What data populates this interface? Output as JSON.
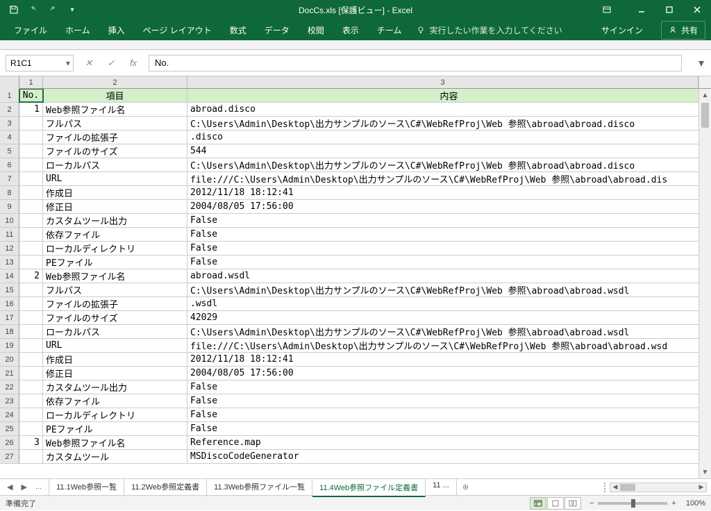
{
  "title": "DocCs.xls  [保護ビュー] - Excel",
  "ribbon": {
    "tabs": [
      "ファイル",
      "ホーム",
      "挿入",
      "ページ レイアウト",
      "数式",
      "データ",
      "校閲",
      "表示",
      "チーム"
    ],
    "tell_me": "実行したい作業を入力してください",
    "signin": "サインイン",
    "share": "共有"
  },
  "formula": {
    "name_box": "R1C1",
    "value": "No."
  },
  "columns": [
    "1",
    "2",
    "3"
  ],
  "header_row": {
    "no": "No.",
    "item": "項目",
    "content": "内容"
  },
  "rows": [
    {
      "rh": "1",
      "no": "",
      "item": "",
      "content": "",
      "header": true
    },
    {
      "rh": "2",
      "no": "1",
      "item": "Web参照ファイル名",
      "content": "abroad.disco"
    },
    {
      "rh": "3",
      "no": "",
      "item": "フルパス",
      "content": "C:\\Users\\Admin\\Desktop\\出力サンプルのソース\\C#\\WebRefProj\\Web 参照\\abroad\\abroad.disco"
    },
    {
      "rh": "4",
      "no": "",
      "item": "ファイルの拡張子",
      "content": ".disco"
    },
    {
      "rh": "5",
      "no": "",
      "item": "ファイルのサイズ",
      "content": "544"
    },
    {
      "rh": "6",
      "no": "",
      "item": "ローカルパス",
      "content": "C:\\Users\\Admin\\Desktop\\出力サンプルのソース\\C#\\WebRefProj\\Web 参照\\abroad\\abroad.disco"
    },
    {
      "rh": "7",
      "no": "",
      "item": "URL",
      "content": "file:///C:\\Users\\Admin\\Desktop\\出力サンプルのソース\\C#\\WebRefProj\\Web 参照\\abroad\\abroad.dis"
    },
    {
      "rh": "8",
      "no": "",
      "item": "作成日",
      "content": "2012/11/18 18:12:41"
    },
    {
      "rh": "9",
      "no": "",
      "item": "修正日",
      "content": "2004/08/05 17:56:00"
    },
    {
      "rh": "10",
      "no": "",
      "item": "カスタムツール出力",
      "content": "False"
    },
    {
      "rh": "11",
      "no": "",
      "item": "依存ファイル",
      "content": "False"
    },
    {
      "rh": "12",
      "no": "",
      "item": "ローカルディレクトリ",
      "content": "False"
    },
    {
      "rh": "13",
      "no": "",
      "item": "PEファイル",
      "content": "False"
    },
    {
      "rh": "14",
      "no": "2",
      "item": "Web参照ファイル名",
      "content": "abroad.wsdl"
    },
    {
      "rh": "15",
      "no": "",
      "item": "フルパス",
      "content": "C:\\Users\\Admin\\Desktop\\出力サンプルのソース\\C#\\WebRefProj\\Web 参照\\abroad\\abroad.wsdl"
    },
    {
      "rh": "16",
      "no": "",
      "item": "ファイルの拡張子",
      "content": ".wsdl"
    },
    {
      "rh": "17",
      "no": "",
      "item": "ファイルのサイズ",
      "content": "42029"
    },
    {
      "rh": "18",
      "no": "",
      "item": "ローカルパス",
      "content": "C:\\Users\\Admin\\Desktop\\出力サンプルのソース\\C#\\WebRefProj\\Web 参照\\abroad\\abroad.wsdl"
    },
    {
      "rh": "19",
      "no": "",
      "item": "URL",
      "content": "file:///C:\\Users\\Admin\\Desktop\\出力サンプルのソース\\C#\\WebRefProj\\Web 参照\\abroad\\abroad.wsd"
    },
    {
      "rh": "20",
      "no": "",
      "item": "作成日",
      "content": "2012/11/18 18:12:41"
    },
    {
      "rh": "21",
      "no": "",
      "item": "修正日",
      "content": "2004/08/05 17:56:00"
    },
    {
      "rh": "22",
      "no": "",
      "item": "カスタムツール出力",
      "content": "False"
    },
    {
      "rh": "23",
      "no": "",
      "item": "依存ファイル",
      "content": "False"
    },
    {
      "rh": "24",
      "no": "",
      "item": "ローカルディレクトリ",
      "content": "False"
    },
    {
      "rh": "25",
      "no": "",
      "item": "PEファイル",
      "content": "False"
    },
    {
      "rh": "26",
      "no": "3",
      "item": "Web参照ファイル名",
      "content": "Reference.map"
    },
    {
      "rh": "27",
      "no": "",
      "item": "カスタムツール",
      "content": "MSDiscoCodeGenerator"
    }
  ],
  "sheets": {
    "overflow_left": "...",
    "tabs": [
      "11.1Web参照一覧",
      "11.2Web参照定義書",
      "11.3Web参照ファイル一覧",
      "11.4Web参照ファイル定義書",
      "11 ..."
    ],
    "active": 3
  },
  "status": {
    "text": "準備完了",
    "zoom": "100%"
  }
}
